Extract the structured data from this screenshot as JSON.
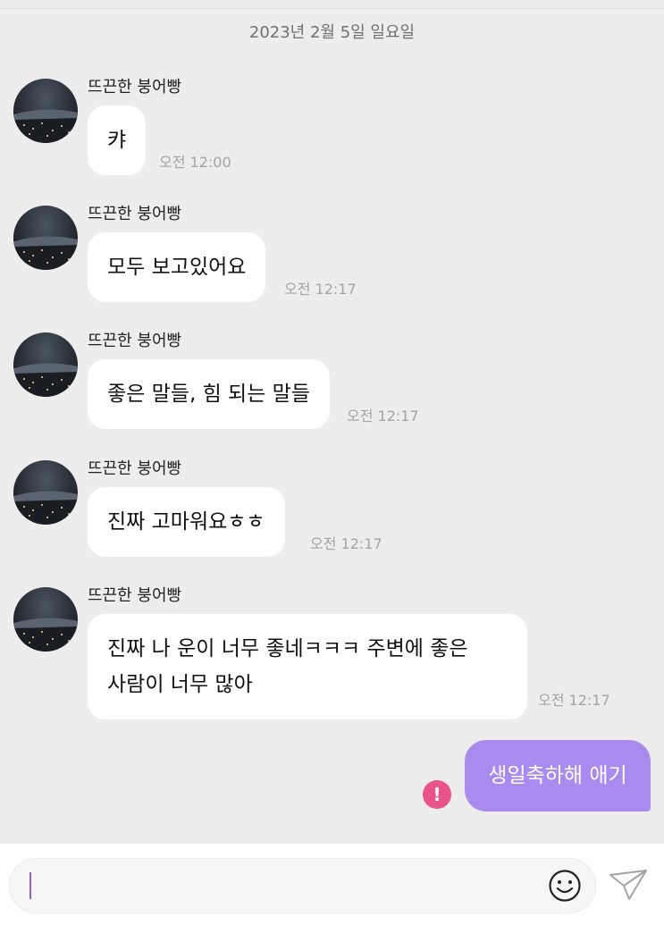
{
  "date_header": "2023년 2월 5일 일요일",
  "messages": [
    {
      "sender": "뜨끈한 붕어빵",
      "text": "캬",
      "time": "오전 12:00"
    },
    {
      "sender": "뜨끈한 붕어빵",
      "text": "모두 보고있어요",
      "time": "오전 12:17"
    },
    {
      "sender": "뜨끈한 붕어빵",
      "text": "좋은 말들, 힘 되는 말들",
      "time": "오전 12:17"
    },
    {
      "sender": "뜨끈한 붕어빵",
      "text": "진짜 고마워요ㅎㅎ",
      "time": "오전 12:17"
    },
    {
      "sender": "뜨끈한 붕어빵",
      "text_lines": [
        "진짜 나 운이 너무 좋네ㅋㅋㅋ 주변에 좋은",
        "사람이 너무 많아"
      ],
      "time": "오전 12:17"
    }
  ],
  "my_message": {
    "text": "생일축하해 애기",
    "status_icon": "error-icon",
    "status_color": "#e8538a",
    "status_glyph": "!"
  },
  "input": {
    "value": "",
    "emoji_icon": "smiley-icon",
    "send_icon": "paper-plane-icon"
  },
  "colors": {
    "background": "#ededed",
    "my_bubble": "#a98bf0",
    "their_bubble": "#ffffff"
  }
}
